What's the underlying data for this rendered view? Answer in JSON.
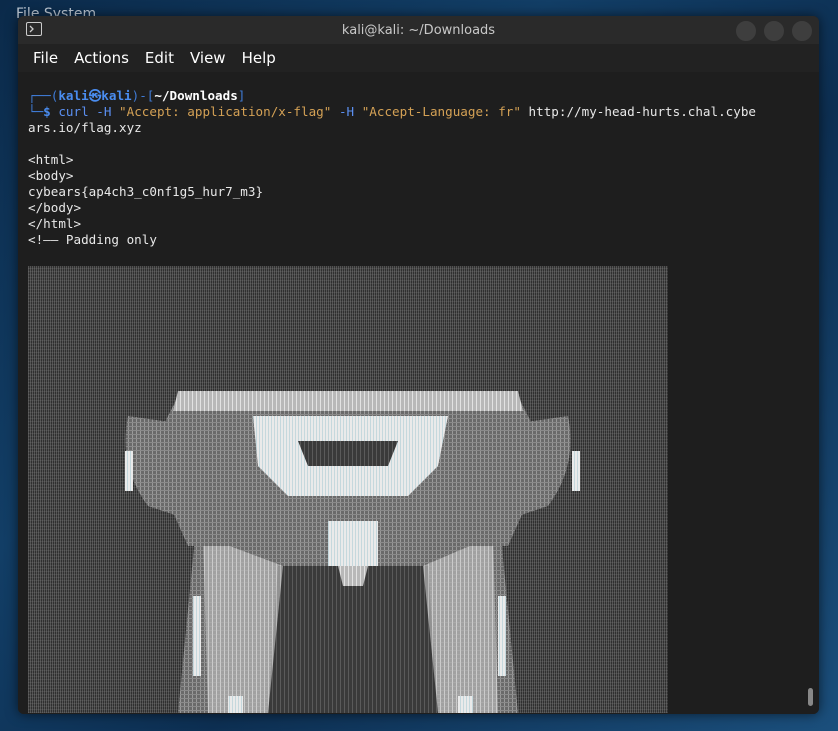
{
  "desktop": {
    "label": "File System"
  },
  "window": {
    "title": "kali@kali: ~/Downloads"
  },
  "menu": [
    "File",
    "Actions",
    "Edit",
    "View",
    "Help"
  ],
  "prompt": {
    "user": "kali",
    "at": "㉿",
    "host": "kali",
    "path": "~/Downloads"
  },
  "command": {
    "cmd": "curl",
    "flag1": "-H",
    "arg1": "\"Accept: application/x-flag\"",
    "flag2": "-H",
    "arg2": "\"Accept-Language: fr\"",
    "url_part1": "http://my-head-hurts.chal.cybe",
    "url_part2": "ars.io/flag.xyz"
  },
  "output": {
    "lines": [
      "<html>",
      "<body>",
      "cybears{ap4ch3_c0nf1g5_hur7_m3}",
      "</body>",
      "</html>",
      "<!—— Padding only"
    ]
  },
  "colors": {
    "prompt": "#3f7bd6",
    "string": "#d4a155",
    "background": "#1e1e1e"
  }
}
